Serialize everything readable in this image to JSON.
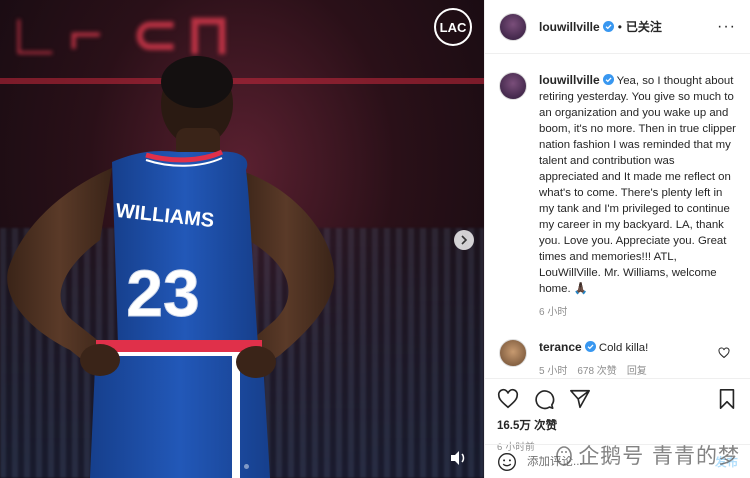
{
  "header": {
    "username": "louwillville",
    "follow_label": "已关注",
    "separator": "•",
    "more": "···"
  },
  "media": {
    "jersey_name": "WILLIAMS",
    "jersey_number": "23",
    "logo_text": "LAC",
    "slide_count": 2,
    "active_slide": 1
  },
  "caption": {
    "username": "louwillville",
    "text": "Yea, so I thought about retiring yesterday. You give so much to an organization and you wake up and boom, it's no more. Then in true clipper nation fashion I was reminded that my talent and contribution was appreciated and It made me reflect on what's to come. There's plenty left in my tank and I'm privileged to continue my career in my backyard. LA, thank you. Love you. Appreciate you. Great times and memories!!! ATL, LouWillVille. Mr. Williams, welcome home. 🙏🏿",
    "time": "6 小时"
  },
  "comment": {
    "username": "terance",
    "text": "Cold killa!",
    "time": "5 小时",
    "likes": "678 次赞",
    "reply_label": "回复"
  },
  "actions": {
    "likes_count": "16.5万 次赞",
    "timestamp": "6 小时前"
  },
  "add_comment": {
    "placeholder": "添加评论...",
    "post_label": "发布"
  },
  "watermark": {
    "text": "企鹅号 青青的梦"
  },
  "colors": {
    "verified": "#3897f0",
    "jersey": "#1d4fa8",
    "accent_red": "#e0304a"
  }
}
